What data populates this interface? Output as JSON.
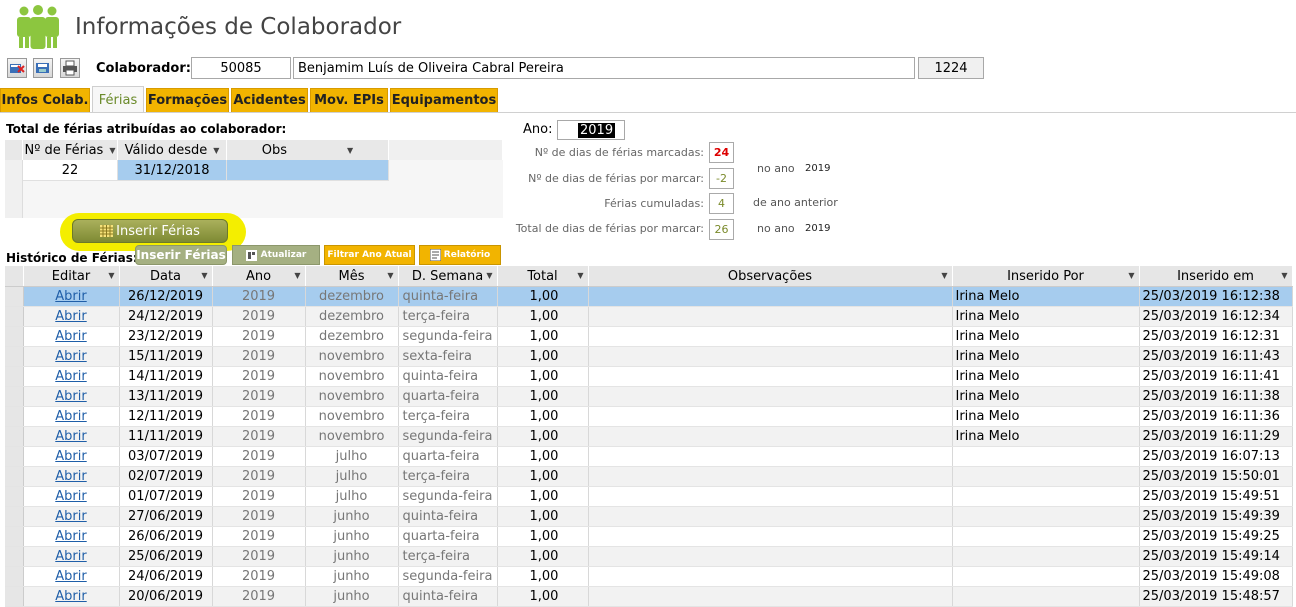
{
  "header": {
    "title": "Informações de Colaborador",
    "logo_icon": "people-group-icon"
  },
  "toolbar": {
    "icons": [
      "edit-record-icon",
      "save-record-icon",
      "print-icon"
    ]
  },
  "colaborador": {
    "label": "Colaborador:",
    "number": "50085",
    "name": "Benjamim Luís de Oliveira Cabral Pereira",
    "code": "1224"
  },
  "tabs": [
    {
      "label": "Infos Colab."
    },
    {
      "label": "Férias",
      "active": true
    },
    {
      "label": "Formações"
    },
    {
      "label": "Acidentes"
    },
    {
      "label": "Mov. EPIs"
    },
    {
      "label": "Equipamentos"
    }
  ],
  "total_section": {
    "title": "Total de férias atribuídas ao colaborador:",
    "columns": [
      "Nº de Férias",
      "Válido desde",
      "Obs"
    ],
    "row": {
      "n_ferias": "22",
      "valido_desde": "31/12/2018",
      "obs": ""
    }
  },
  "ano": {
    "label": "Ano:",
    "value": "2019"
  },
  "stats": {
    "marcadas_label": "Nº de dias de férias marcadas:",
    "marcadas": "24",
    "por_marcar_label": "Nº de dias de férias por marcar:",
    "por_marcar": "-2",
    "no_ano_label": "no ano",
    "no_ano_value": "2019",
    "cumuladas_label": "Férias cumuladas:",
    "cumuladas": "4",
    "ano_anterior_label": "de ano anterior",
    "total_label": "Total de dias de férias por marcar:",
    "total": "26",
    "total_no_ano_label": "no ano",
    "total_no_ano_value": "2019"
  },
  "buttons": {
    "inserir_big": "Inserir Férias",
    "inserir_small": "Inserir Férias",
    "atualizar": "Atualizar",
    "filtrar": "Filtrar Ano Atual",
    "relatorio": "Relatório"
  },
  "historico": {
    "title": "Histórico de Férias:",
    "columns": [
      "Editar",
      "Data",
      "Ano",
      "Mês",
      "D. Semana",
      "Total",
      "Observações",
      "Inserido Por",
      "Inserido em"
    ],
    "rows": [
      {
        "editar": "Abrir",
        "data": "26/12/2019",
        "ano": "2019",
        "mes": "dezembro",
        "dsemana": "quinta-feira",
        "total": "1,00",
        "obs": "",
        "por": "Irina Melo",
        "em": "25/03/2019 16:12:38"
      },
      {
        "editar": "Abrir",
        "data": "24/12/2019",
        "ano": "2019",
        "mes": "dezembro",
        "dsemana": "terça-feira",
        "total": "1,00",
        "obs": "",
        "por": "Irina Melo",
        "em": "25/03/2019 16:12:34"
      },
      {
        "editar": "Abrir",
        "data": "23/12/2019",
        "ano": "2019",
        "mes": "dezembro",
        "dsemana": "segunda-feira",
        "total": "1,00",
        "obs": "",
        "por": "Irina Melo",
        "em": "25/03/2019 16:12:31"
      },
      {
        "editar": "Abrir",
        "data": "15/11/2019",
        "ano": "2019",
        "mes": "novembro",
        "dsemana": "sexta-feira",
        "total": "1,00",
        "obs": "",
        "por": "Irina Melo",
        "em": "25/03/2019 16:11:43"
      },
      {
        "editar": "Abrir",
        "data": "14/11/2019",
        "ano": "2019",
        "mes": "novembro",
        "dsemana": "quinta-feira",
        "total": "1,00",
        "obs": "",
        "por": "Irina Melo",
        "em": "25/03/2019 16:11:41"
      },
      {
        "editar": "Abrir",
        "data": "13/11/2019",
        "ano": "2019",
        "mes": "novembro",
        "dsemana": "quarta-feira",
        "total": "1,00",
        "obs": "",
        "por": "Irina Melo",
        "em": "25/03/2019 16:11:38"
      },
      {
        "editar": "Abrir",
        "data": "12/11/2019",
        "ano": "2019",
        "mes": "novembro",
        "dsemana": "terça-feira",
        "total": "1,00",
        "obs": "",
        "por": "Irina Melo",
        "em": "25/03/2019 16:11:36"
      },
      {
        "editar": "Abrir",
        "data": "11/11/2019",
        "ano": "2019",
        "mes": "novembro",
        "dsemana": "segunda-feira",
        "total": "1,00",
        "obs": "",
        "por": "Irina Melo",
        "em": "25/03/2019 16:11:29"
      },
      {
        "editar": "Abrir",
        "data": "03/07/2019",
        "ano": "2019",
        "mes": "julho",
        "dsemana": "quarta-feira",
        "total": "1,00",
        "obs": "",
        "por": "",
        "em": "25/03/2019 16:07:13"
      },
      {
        "editar": "Abrir",
        "data": "02/07/2019",
        "ano": "2019",
        "mes": "julho",
        "dsemana": "terça-feira",
        "total": "1,00",
        "obs": "",
        "por": "",
        "em": "25/03/2019 15:50:01"
      },
      {
        "editar": "Abrir",
        "data": "01/07/2019",
        "ano": "2019",
        "mes": "julho",
        "dsemana": "segunda-feira",
        "total": "1,00",
        "obs": "",
        "por": "",
        "em": "25/03/2019 15:49:51"
      },
      {
        "editar": "Abrir",
        "data": "27/06/2019",
        "ano": "2019",
        "mes": "junho",
        "dsemana": "quinta-feira",
        "total": "1,00",
        "obs": "",
        "por": "",
        "em": "25/03/2019 15:49:39"
      },
      {
        "editar": "Abrir",
        "data": "26/06/2019",
        "ano": "2019",
        "mes": "junho",
        "dsemana": "quarta-feira",
        "total": "1,00",
        "obs": "",
        "por": "",
        "em": "25/03/2019 15:49:25"
      },
      {
        "editar": "Abrir",
        "data": "25/06/2019",
        "ano": "2019",
        "mes": "junho",
        "dsemana": "terça-feira",
        "total": "1,00",
        "obs": "",
        "por": "",
        "em": "25/03/2019 15:49:14"
      },
      {
        "editar": "Abrir",
        "data": "24/06/2019",
        "ano": "2019",
        "mes": "junho",
        "dsemana": "segunda-feira",
        "total": "1,00",
        "obs": "",
        "por": "",
        "em": "25/03/2019 15:49:08"
      },
      {
        "editar": "Abrir",
        "data": "20/06/2019",
        "ano": "2019",
        "mes": "junho",
        "dsemana": "quinta-feira",
        "total": "1,00",
        "obs": "",
        "por": "",
        "em": "25/03/2019 15:48:57"
      }
    ]
  },
  "colors": {
    "accent_yellow": "#f2b400",
    "logo_green": "#8cc63f",
    "selection_blue": "#a6ccee",
    "highlight": "#f4ee00"
  }
}
